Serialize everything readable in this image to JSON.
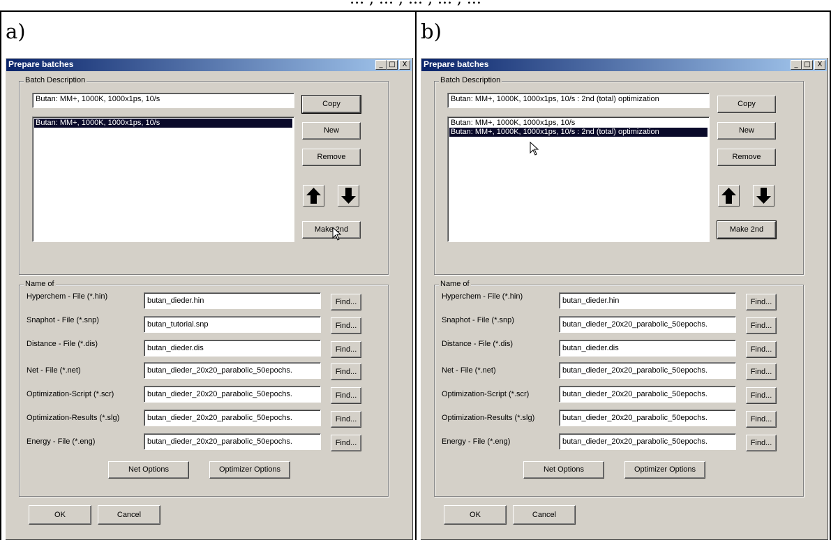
{
  "top_caption": "... , ... , ... , ... , ...",
  "panels": [
    {
      "letter": "a)",
      "window_title": "Prepare batches",
      "titlebar_buttons": [
        "_",
        "□",
        "X"
      ],
      "batch_group_label": "Batch Description",
      "batch_description_value": "Butan: MM+, 1000K, 1000x1ps, 10/s",
      "batch_list": [
        {
          "text": "Butan: MM+, 1000K, 1000x1ps, 10/s",
          "selected": true
        }
      ],
      "buttons": {
        "copy": "Copy",
        "new": "New",
        "remove": "Remove",
        "make2nd": "Make 2nd"
      },
      "name_group_label": "Name of",
      "files": [
        {
          "label": "Hyperchem - File (*.hin)",
          "value": "butan_dieder.hin",
          "find": "Find..."
        },
        {
          "label": "Snaphot - File (*.snp)",
          "value": "butan_tutorial.snp",
          "find": "Find..."
        },
        {
          "label": "Distance - File (*.dis)",
          "value": "butan_dieder.dis",
          "find": "Find..."
        },
        {
          "label": "Net - File (*.net)",
          "value": "butan_dieder_20x20_parabolic_50epochs.",
          "find": "Find..."
        },
        {
          "label": "Optimization-Script (*.scr)",
          "value": "butan_dieder_20x20_parabolic_50epochs.",
          "find": "Find..."
        },
        {
          "label": "Optimization-Results (*.slg)",
          "value": "butan_dieder_20x20_parabolic_50epochs.",
          "find": "Find..."
        },
        {
          "label": "Energy - File (*.eng)",
          "value": "butan_dieder_20x20_parabolic_50epochs.",
          "find": "Find..."
        }
      ],
      "net_options": "Net Options",
      "optimizer_options": "Optimizer Options",
      "ok": "OK",
      "cancel": "Cancel"
    },
    {
      "letter": "b)",
      "window_title": "Prepare batches",
      "titlebar_buttons": [
        "_",
        "□",
        "X"
      ],
      "batch_group_label": "Batch Description",
      "batch_description_value": "Butan: MM+, 1000K, 1000x1ps, 10/s : 2nd (total) optimization",
      "batch_list": [
        {
          "text": "Butan: MM+, 1000K, 1000x1ps, 10/s",
          "selected": false
        },
        {
          "text": "Butan: MM+, 1000K, 1000x1ps, 10/s : 2nd (total) optimization",
          "selected": true
        }
      ],
      "buttons": {
        "copy": "Copy",
        "new": "New",
        "remove": "Remove",
        "make2nd": "Make 2nd"
      },
      "name_group_label": "Name of",
      "files": [
        {
          "label": "Hyperchem - File (*.hin)",
          "value": "butan_dieder.hin",
          "find": "Find..."
        },
        {
          "label": "Snaphot - File (*.snp)",
          "value": "butan_dieder_20x20_parabolic_50epochs.",
          "find": "Find..."
        },
        {
          "label": "Distance - File (*.dis)",
          "value": "butan_dieder.dis",
          "find": "Find..."
        },
        {
          "label": "Net - File (*.net)",
          "value": "butan_dieder_20x20_parabolic_50epochs.",
          "find": "Find..."
        },
        {
          "label": "Optimization-Script (*.scr)",
          "value": "butan_dieder_20x20_parabolic_50epochs.",
          "find": "Find..."
        },
        {
          "label": "Optimization-Results (*.slg)",
          "value": "butan_dieder_20x20_parabolic_50epochs.",
          "find": "Find..."
        },
        {
          "label": "Energy - File (*.eng)",
          "value": "butan_dieder_20x20_parabolic_50epochs.",
          "find": "Find..."
        }
      ],
      "net_options": "Net Options",
      "optimizer_options": "Optimizer Options",
      "ok": "OK",
      "cancel": "Cancel"
    }
  ]
}
